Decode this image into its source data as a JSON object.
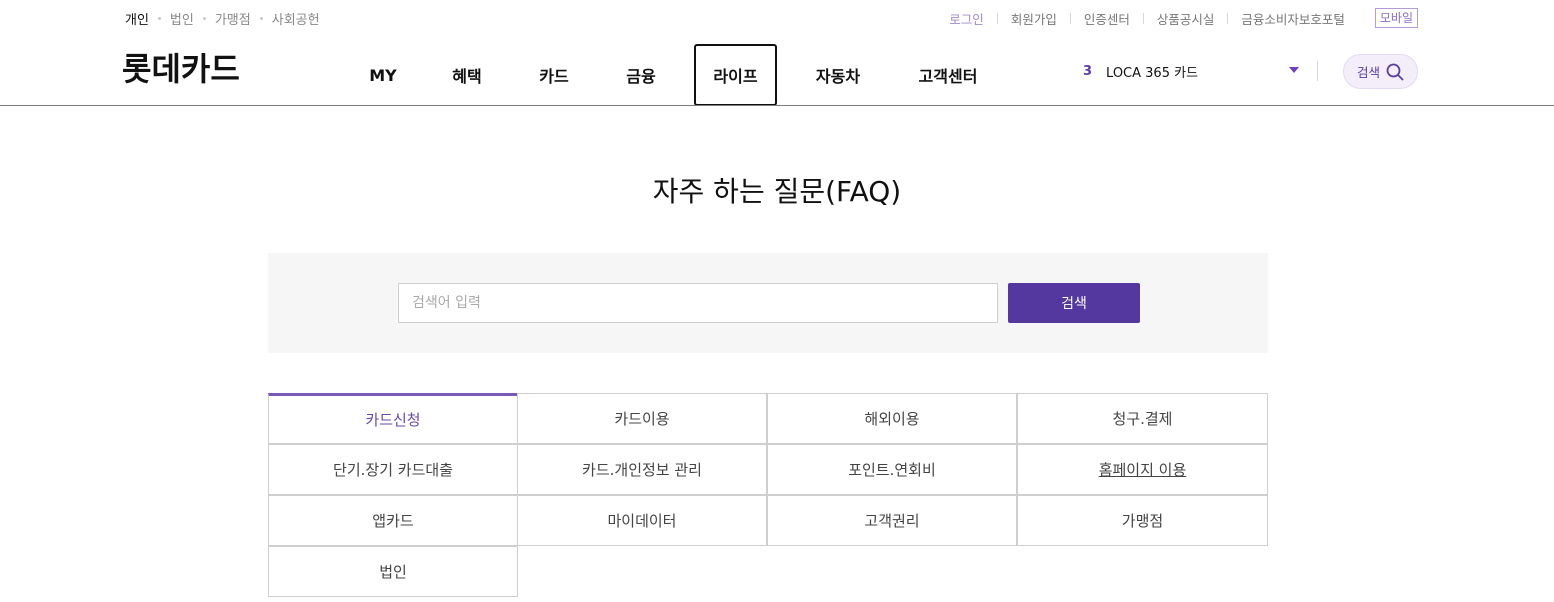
{
  "util_nav": {
    "left": [
      {
        "label": "개인",
        "active": true
      },
      {
        "label": "법인",
        "active": false
      },
      {
        "label": "가맹점",
        "active": false
      },
      {
        "label": "사회공헌",
        "active": false
      }
    ],
    "right": [
      "로그인",
      "회원가입",
      "인증센터",
      "상품공시실",
      "금융소비자보호포털"
    ],
    "mobile": "모바일"
  },
  "logo": "롯데카드",
  "gnb": [
    "MY",
    "혜택",
    "카드",
    "금융",
    "라이프",
    "자동차",
    "고객센터"
  ],
  "gnb_selected": "라이프",
  "card_select": {
    "number": "3",
    "name": "LOCA 365 카드"
  },
  "search_pill": {
    "label": "검색",
    "icon": "search-icon"
  },
  "page_title": "자주 하는 질문(FAQ)",
  "faq_search": {
    "placeholder": "검색어 입력",
    "value": "",
    "button": "검색"
  },
  "categories": [
    {
      "label": "카드신청",
      "active": true
    },
    {
      "label": "카드이용"
    },
    {
      "label": "해외이용"
    },
    {
      "label": "청구.결제"
    },
    {
      "label": "단기.장기 카드대출"
    },
    {
      "label": "카드.개인정보 관리"
    },
    {
      "label": "포인트.연회비"
    },
    {
      "label": "홈페이지 이용",
      "hovered": true
    },
    {
      "label": "앱카드"
    },
    {
      "label": "마이데이터"
    },
    {
      "label": "고객권리"
    },
    {
      "label": "가맹점"
    },
    {
      "label": "법인"
    }
  ],
  "colors": {
    "accent": "#54389f",
    "active_tab": "#7a59b8",
    "pill_bg": "#f3eef9"
  }
}
